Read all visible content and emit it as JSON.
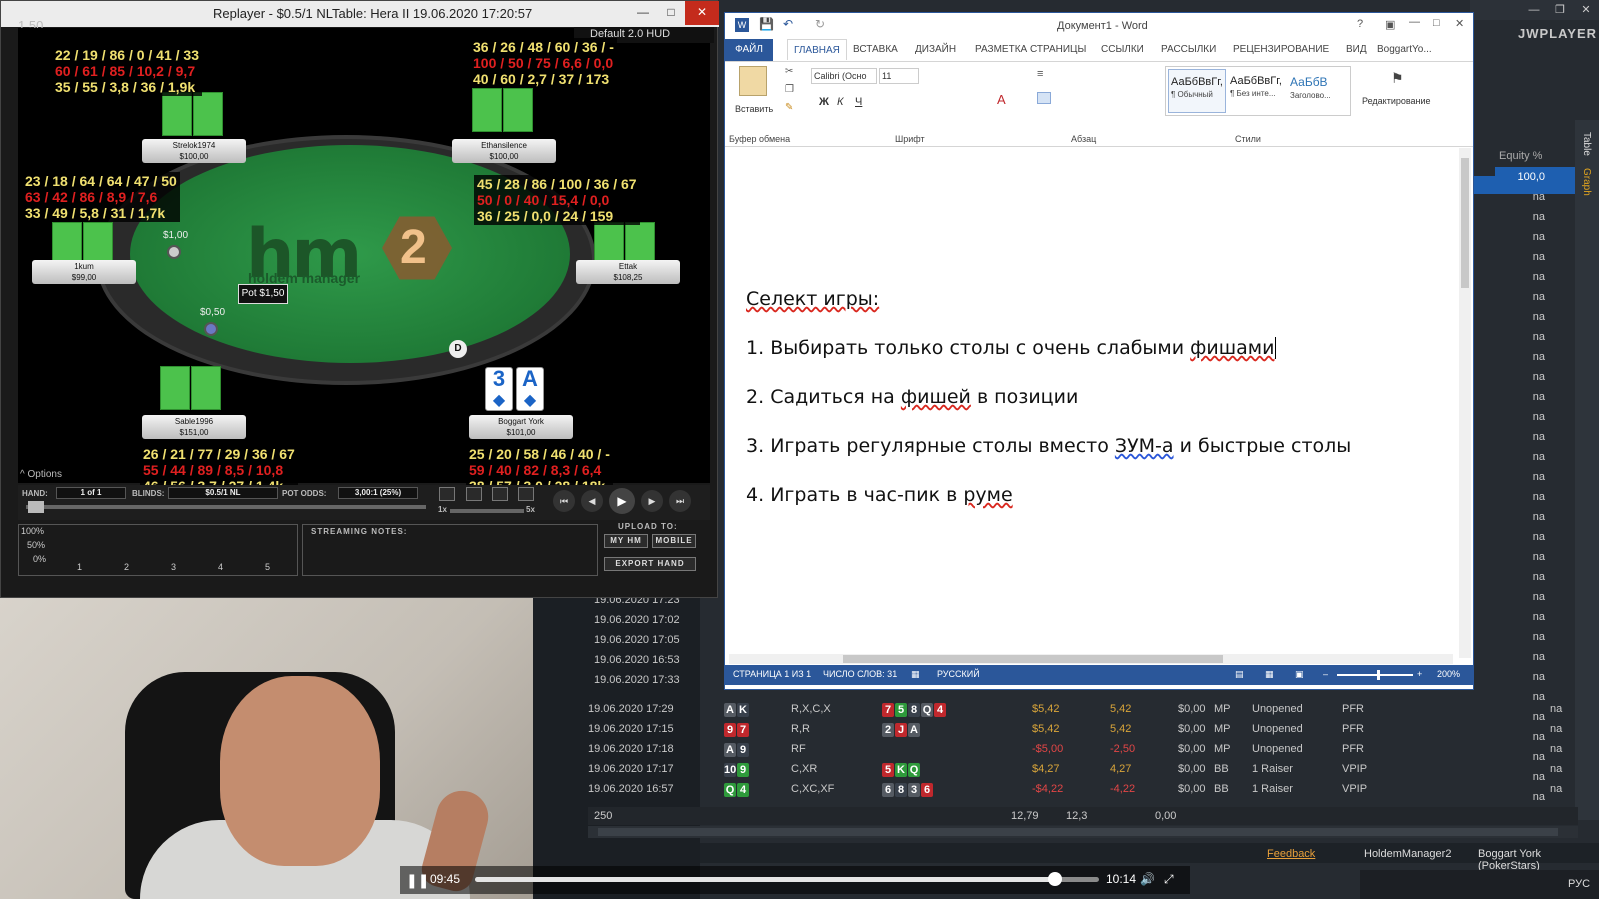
{
  "replayer": {
    "title": "Replayer - $0.5/1 NLTable: Hera II    19.06.2020 17:20:57",
    "corner": "1.50",
    "hud_label": "Default 2.0 HUD",
    "pot": "Pot $1,50",
    "bet_left": "$1,00",
    "bet_small": "$0,50",
    "dealer": "D",
    "logo_main": "hm",
    "logo_num": "2",
    "logo_sub": "holdem manager",
    "hero_cards": [
      "3",
      "A"
    ],
    "seats": [
      {
        "name": "Strelok1974",
        "stack": "$100,00"
      },
      {
        "name": "Ethansilence",
        "stack": "$100,00"
      },
      {
        "name": "1kum",
        "stack": "$99,00"
      },
      {
        "name": "Ettak",
        "stack": "$108,25"
      },
      {
        "name": "Sable1996",
        "stack": "$151,00"
      },
      {
        "name": "Boggart York",
        "stack": "$101,00"
      }
    ],
    "huds": [
      {
        "l1": "22 / 19 / 86 / 0 / 41 / 33",
        "l2": "60 / 61 / 85 / 10,2 / 9,7",
        "l3": "35 / 55 / 3,8 / 36 / 1,9k"
      },
      {
        "l1": "36 / 26 / 48 / 60 / 36 / -",
        "l2": "100 / 50 / 75 / 6,6 / 0,0",
        "l3": "40 / 60 / 2,7 / 37 / 173"
      },
      {
        "l1": "23 / 18 / 64 / 64 / 47 / 50",
        "l2": "63 / 42 / 86 / 8,9 / 7,6",
        "l3": "33 / 49 / 5,8 / 31 / 1,7k"
      },
      {
        "l1": "45 / 28 / 86 / 100 / 36 / 67",
        "l2": "50 / 0 / 40 / 15,4 / 0,0",
        "l3": "36 / 25 / 0,0 / 24 / 159"
      },
      {
        "l1": "26 / 21 / 77 / 29 / 36 / 67",
        "l2": "55 / 44 / 89 / 8,5 / 10,8",
        "l3": "46 / 56 / 3,7 / 27 / 1,4k"
      },
      {
        "l1": "25 / 20 / 58 / 46 / 40 / -",
        "l2": "59 / 40 / 82 / 8,3 / 6,4",
        "l3": "38 / 57 / 3,0 / 28 / 18k"
      }
    ],
    "options": "Options",
    "hand_label": "HAND:",
    "hand_value": "1 of 1",
    "blinds_label": "BLINDS:",
    "blinds_value": "$0.5/1 NL",
    "pot_odds_label": "POT ODDS:",
    "pot_odds_value": "3,00:1 (25%)",
    "speed_min": "1x",
    "speed_max": "5x",
    "graph_y": [
      "100%",
      "50%",
      "0%"
    ],
    "graph_x": [
      "1",
      "2",
      "3",
      "4",
      "5"
    ],
    "streaming_notes": "STREAMING NOTES:",
    "upload_to": "UPLOAD TO:",
    "my_hm": "MY HM",
    "mobile": "MOBILE",
    "export_hand": "EXPORT HAND"
  },
  "word": {
    "title": "Документ1 - Word",
    "tabs": [
      "ФАЙЛ",
      "ГЛАВНАЯ",
      "ВСТАВКА",
      "ДИЗАЙН",
      "РАЗМЕТКА СТРАНИЦЫ",
      "ССЫЛКИ",
      "РАССЫЛКИ",
      "РЕЦЕНЗИРОВАНИЕ",
      "ВИД"
    ],
    "user": "BoggartYo...",
    "paste": "Вставить",
    "font_name": "Calibri (Осно",
    "font_size": "11",
    "groups": {
      "clipboard": "Буфер обмена",
      "font": "Шрифт",
      "para": "Абзац",
      "styles": "Стили"
    },
    "styles": [
      {
        "prev": "АаБбВвГг,",
        "name": "¶ Обычный"
      },
      {
        "prev": "АаБбВвГг,",
        "name": "¶ Без инте..."
      },
      {
        "prev": "АаБбВ",
        "name": "Заголово..."
      }
    ],
    "editing": "Редактирование",
    "heading": "Селект игры:",
    "items": [
      {
        "num": "1.",
        "text": "Выбирать только столы с очень слабыми ",
        "mark": "фишами"
      },
      {
        "num": "2.",
        "text_a": "Садиться на ",
        "mark": "фишей",
        "text_b": " в позиции"
      },
      {
        "num": "3.",
        "text_a": "Играть регулярные столы вместо ",
        "mark": "ЗУМ-а",
        "text_b": " и быстрые столы"
      },
      {
        "num": "4.",
        "text_a": "Играть в час-пик в ",
        "mark": "руме"
      }
    ],
    "status": {
      "page": "СТРАНИЦА 1 ИЗ 1",
      "words": "ЧИСЛО СЛОВ: 31",
      "lang": "РУССКИЙ",
      "zoom": "200%"
    }
  },
  "hm": {
    "jwplayer": "JWPLAYER",
    "side_tabs": [
      "Table",
      "Graph"
    ],
    "equity_head": "Equity %",
    "equity": [
      "100,0",
      "na",
      "na",
      "na",
      "na",
      "na",
      "na",
      "na",
      "na",
      "na",
      "na",
      "na",
      "na",
      "na",
      "na",
      "na",
      "na",
      "na",
      "na",
      "na",
      "na",
      "na",
      "na",
      "na",
      "na",
      "na",
      "na",
      "na",
      "na",
      "na",
      "na",
      "na"
    ],
    "sessions": [
      "19.06.2020 17:23",
      "19.06.2020 17:02",
      "19.06.2020 17:05",
      "19.06.2020 16:53",
      "19.06.2020 17:33"
    ],
    "rows": [
      {
        "date": "19.06.2020 17:29",
        "hole": [
          [
            "A",
            "cgr"
          ],
          [
            "K",
            "cb"
          ]
        ],
        "action": "R,X,C,X",
        "board": [
          [
            "7",
            "cr"
          ],
          [
            "5",
            "cg"
          ],
          [
            "8",
            "cb"
          ],
          [
            "Q",
            "cgr"
          ],
          [
            "4",
            "cr"
          ]
        ],
        "won": "$5,42",
        "bb": "5,42",
        "rake": "$0,00",
        "pos": "MP",
        "pre": "Unopened",
        "stat": "PFR",
        "eq": "na"
      },
      {
        "date": "19.06.2020 17:15",
        "hole": [
          [
            "9",
            "cr"
          ],
          [
            "7",
            "cr"
          ]
        ],
        "action": "R,R",
        "board": [
          [
            "2",
            "cgr"
          ],
          [
            "J",
            "cr"
          ],
          [
            "A",
            "cgr"
          ]
        ],
        "won": "$5,42",
        "bb": "5,42",
        "rake": "$0,00",
        "pos": "MP",
        "pre": "Unopened",
        "stat": "PFR",
        "eq": "na"
      },
      {
        "date": "19.06.2020 17:18",
        "hole": [
          [
            "A",
            "cgr"
          ],
          [
            "9",
            "cb"
          ]
        ],
        "action": "RF",
        "board": [],
        "won": "-$5,00",
        "bb": "-2,50",
        "rake": "$0,00",
        "pos": "MP",
        "pre": "Unopened",
        "stat": "PFR",
        "eq": "na"
      },
      {
        "date": "19.06.2020 17:17",
        "hole": [
          [
            "10",
            "cb"
          ],
          [
            "9",
            "cg"
          ]
        ],
        "action": "C,XR",
        "board": [
          [
            "5",
            "cr"
          ],
          [
            "K",
            "cg"
          ],
          [
            "Q",
            "cg"
          ]
        ],
        "won": "$4,27",
        "bb": "4,27",
        "rake": "$0,00",
        "pos": "BB",
        "pre": "1 Raiser",
        "stat": "VPIP",
        "eq": "na"
      },
      {
        "date": "19.06.2020 16:57",
        "hole": [
          [
            "Q",
            "cg"
          ],
          [
            "4",
            "cg"
          ]
        ],
        "action": "C,XC,XF",
        "board": [
          [
            "6",
            "cgr"
          ],
          [
            "8",
            "cb"
          ],
          [
            "3",
            "cgr"
          ],
          [
            "6",
            "cr"
          ]
        ],
        "won": "-$4,22",
        "bb": "-4,22",
        "rake": "$0,00",
        "pos": "BB",
        "pre": "1 Raiser",
        "stat": "VPIP",
        "eq": "na"
      }
    ],
    "totals": {
      "count": "250",
      "won": "12,79",
      "bb": "12,3",
      "rake": "0,00"
    },
    "feedback": "Feedback",
    "hm2": "HoldemManager2",
    "player": "Boggart York (PokerStars)",
    "lang": "РУС"
  },
  "video": {
    "current": "09:45",
    "total": "10:14",
    "progress": 0.93
  }
}
